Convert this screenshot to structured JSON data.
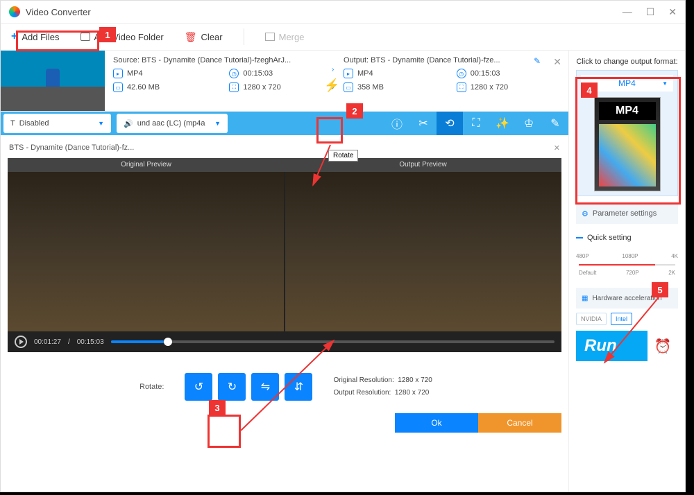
{
  "window": {
    "title": "Video Converter"
  },
  "toolbar": {
    "add_files": "Add Files",
    "add_folder": "Add Video Folder",
    "clear": "Clear",
    "merge": "Merge"
  },
  "file": {
    "source_label": "Source: BTS - Dynamite (Dance Tutorial)-fzeghArJ...",
    "output_label": "Output: BTS - Dynamite (Dance Tutorial)-fze...",
    "src": {
      "format": "MP4",
      "duration": "00:15:03",
      "size": "42.60 MB",
      "dimensions": "1280 x 720"
    },
    "out": {
      "format": "MP4",
      "duration": "00:15:03",
      "size": "358 MB",
      "dimensions": "1280 x 720"
    }
  },
  "subbar": {
    "subtitle": "Disabled",
    "audio": "und aac (LC) (mp4a"
  },
  "tooltip": {
    "rotate": "Rotate"
  },
  "preview": {
    "title": "BTS - Dynamite (Dance Tutorial)-fz...",
    "original_label": "Original Preview",
    "output_label": "Output Preview",
    "time_current": "00:01:27",
    "time_total": "00:15:03"
  },
  "rotate": {
    "label": "Rotate:",
    "orig_res_label": "Original Resolution:",
    "orig_res": "1280 x 720",
    "out_res_label": "Output Resolution:",
    "out_res": "1280 x 720"
  },
  "buttons": {
    "ok": "Ok",
    "cancel": "Cancel"
  },
  "sidebar": {
    "format_label": "Click to change output format:",
    "format": "MP4",
    "format_badge": "MP4",
    "param_settings": "Parameter settings",
    "quick_setting": "Quick setting",
    "marks_top": [
      "480P",
      "1080P",
      "4K"
    ],
    "marks_bot": [
      "Default",
      "720P",
      "2K"
    ],
    "hw_accel": "Hardware acceleration",
    "nvidia": "NVIDIA",
    "intel": "Intel",
    "run": "Run"
  },
  "callouts": {
    "c1": "1",
    "c2": "2",
    "c3": "3",
    "c4": "4",
    "c5": "5"
  }
}
